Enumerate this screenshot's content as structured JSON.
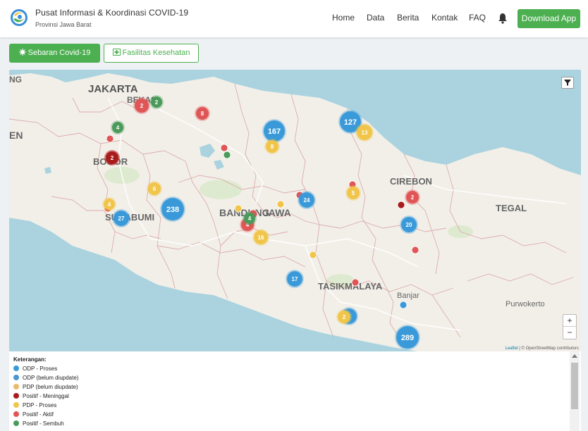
{
  "header": {
    "title": "Pusat Informasi & Koordinasi COVID-19",
    "subtitle": "Provinsi Jawa Barat",
    "nav": [
      "Home",
      "Data",
      "Berita",
      "Kontak",
      "FAQ"
    ],
    "bell_icon": "bell-icon",
    "download_label": "Download App",
    "colors": {
      "brand_green": "#4caf50"
    }
  },
  "tabs": {
    "sebaran_label": "Sebaran Covid-19",
    "sebaran_icon": "virus-icon",
    "fasilitas_label": "Fasilitas Kesehatan",
    "fasilitas_icon": "hospital-icon"
  },
  "map": {
    "filter_icon": "filter-icon",
    "zoom_in": "+",
    "zoom_out": "−",
    "attribution_leaflet": "Leaflet",
    "attribution_osm": " | © OpenStreetMap contributors",
    "place_labels": [
      "JAKARTA",
      "BEKASI",
      "EN",
      "NG",
      "BOGOR",
      "SUKABUMI",
      "BANDUNG",
      "JAWA",
      "CIREBON",
      "TEGAL",
      "TASIKMALAYA",
      "Banjar",
      "Purwokerto"
    ],
    "clusters": [
      {
        "category": "odp-proses",
        "count": "167"
      },
      {
        "category": "odp-proses",
        "count": "127"
      },
      {
        "category": "pdp-proses",
        "count": "13"
      },
      {
        "category": "odp-proses",
        "count": "238"
      },
      {
        "category": "odp-proses",
        "count": "27"
      },
      {
        "category": "odp-proses",
        "count": "24"
      },
      {
        "category": "odp-proses",
        "count": "20"
      },
      {
        "category": "odp-proses",
        "count": "17"
      },
      {
        "category": "odp-proses",
        "count": "289"
      },
      {
        "category": "odp-proses",
        "count": "5"
      },
      {
        "category": "pdp-proses",
        "count": "2"
      },
      {
        "category": "pdp-proses",
        "count": "16"
      },
      {
        "category": "pdp-proses",
        "count": "8"
      },
      {
        "category": "pdp-proses",
        "count": "6"
      },
      {
        "category": "pdp-proses",
        "count": "5"
      },
      {
        "category": "pdp-proses",
        "count": "4"
      },
      {
        "category": "positif-aktif",
        "count": "8"
      },
      {
        "category": "positif-aktif",
        "count": "2"
      },
      {
        "category": "positif-aktif",
        "count": "2"
      },
      {
        "category": "positif-aktif",
        "count": "4"
      },
      {
        "category": "positif-aktif",
        "count": "2"
      },
      {
        "category": "positif-sembuh",
        "count": "2"
      },
      {
        "category": "positif-sembuh",
        "count": "4"
      },
      {
        "category": "positif-sembuh",
        "count": "4"
      },
      {
        "category": "positif-meninggal",
        "count": "2"
      }
    ]
  },
  "legend": {
    "title": "Keterangan:",
    "items": [
      {
        "label": "ODP - Proses",
        "color": "#3a9ad9"
      },
      {
        "label": "ODP (belum diupdate)",
        "color": "#4a96d0"
      },
      {
        "label": "PDP (belum diupdate)",
        "color": "#e8bb6a"
      },
      {
        "label": "Positif - Meninggal",
        "color": "#a81c1c"
      },
      {
        "label": "PDP - Proses",
        "color": "#f0c54a"
      },
      {
        "label": "Positif - Aktif",
        "color": "#e05555"
      },
      {
        "label": "Positif - Sembuh",
        "color": "#4a9a5a"
      }
    ]
  }
}
